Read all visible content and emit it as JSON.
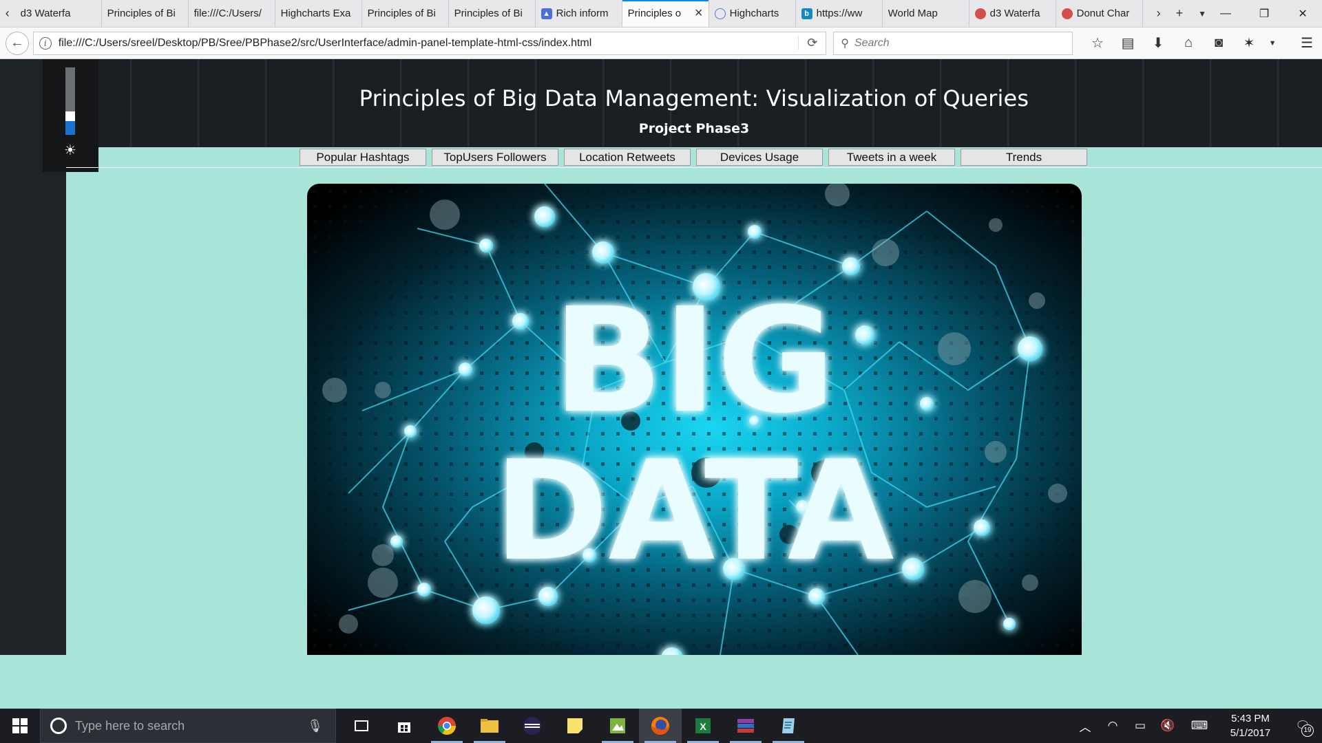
{
  "browser": {
    "tabs": [
      {
        "title": "d3 Waterfa",
        "icon": "none"
      },
      {
        "title": "Principles of Bi",
        "icon": "none"
      },
      {
        "title": "file:///C:/Users/",
        "icon": "none"
      },
      {
        "title": "Highcharts Exa",
        "icon": "none"
      },
      {
        "title": "Principles of Bi",
        "icon": "none"
      },
      {
        "title": "Principles of Bi",
        "icon": "none"
      },
      {
        "title": "Rich inform",
        "icon": "search-console-icon"
      },
      {
        "title": "Principles o",
        "icon": "none",
        "active": true
      },
      {
        "title": "Highcharts",
        "icon": "cloud-icon"
      },
      {
        "title": "https://ww",
        "icon": "bing-icon"
      },
      {
        "title": "World Map",
        "icon": "none"
      },
      {
        "title": "d3 Waterfa",
        "icon": "globe-icon"
      },
      {
        "title": "Donut Char",
        "icon": "globe-icon"
      }
    ],
    "url": "file:///C:/Users/sreel/Desktop/PB/Sree/PBPhase2/src/UserInterface/admin-panel-template-html-css/index.html",
    "search_placeholder": "Search"
  },
  "page": {
    "title": "Principles of Big Data Management: Visualization of Queries",
    "subtitle": "Project Phase3",
    "menu": [
      "Popular Hashtags",
      "TopUsers Followers",
      "Location Retweets",
      "Devices Usage",
      "Tweets in a week",
      "Trends"
    ],
    "hero": {
      "line1": "BIG",
      "line2": "DATA"
    },
    "brightness_level": 0.2
  },
  "taskbar": {
    "search_placeholder": "Type here to search",
    "time": "5:43 PM",
    "date": "5/1/2017",
    "notification_count": "19"
  },
  "colors": {
    "page_bg": "#a8e4d8",
    "header_bg": "#1a1d22",
    "accent_blue": "#0a84ff",
    "hero_glow": "#19d6f2"
  }
}
